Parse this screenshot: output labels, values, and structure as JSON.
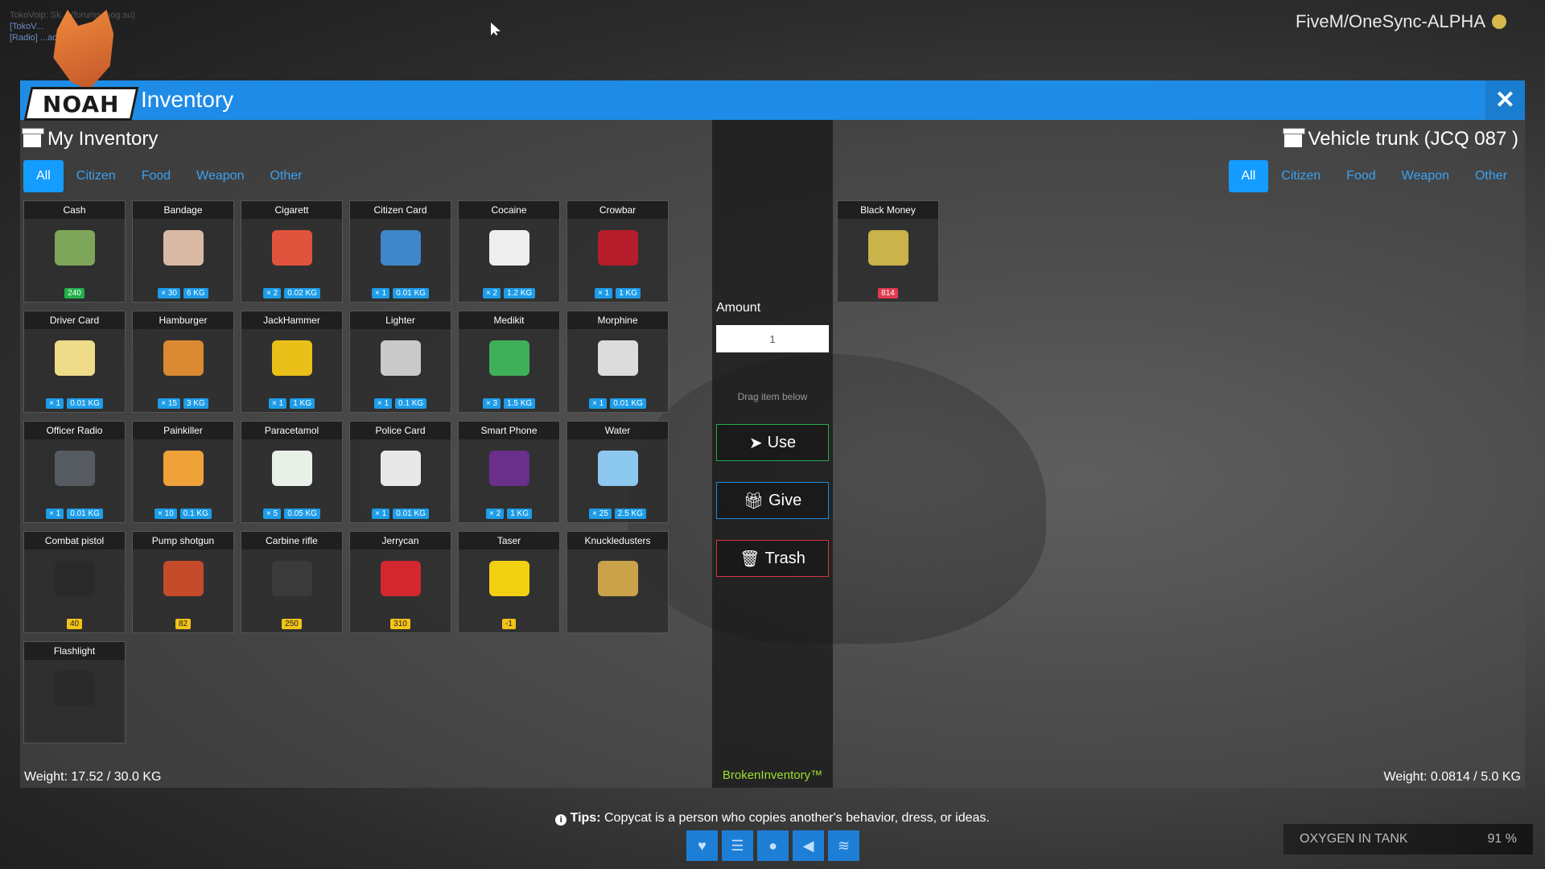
{
  "server_tag": "FiveM/OneSync-ALPHA",
  "chat": [
    "TokoVoip: Sk... (forums.mog.su)",
    "[TokoV...",
    "[Radio] ...adio"
  ],
  "header": {
    "title": "Inventory",
    "brand": "NOAH"
  },
  "left": {
    "title": "My Inventory",
    "filters": [
      "All",
      "Citizen",
      "Food",
      "Weapon",
      "Other"
    ],
    "weight": "Weight: 17.52 / 30.0 KG",
    "items": [
      {
        "name": "Cash",
        "tags": [
          {
            "text": "240",
            "kind": "green"
          }
        ],
        "color": "#7ea65a"
      },
      {
        "name": "Bandage",
        "tags": [
          {
            "text": "× 30",
            "kind": "blue"
          },
          {
            "text": "6 KG",
            "kind": "blue"
          }
        ],
        "color": "#d9b9a3"
      },
      {
        "name": "Cigarett",
        "tags": [
          {
            "text": "× 2",
            "kind": "blue"
          },
          {
            "text": "0.02 KG",
            "kind": "blue"
          }
        ],
        "color": "#e0533d"
      },
      {
        "name": "Citizen Card",
        "tags": [
          {
            "text": "× 1",
            "kind": "blue"
          },
          {
            "text": "0.01 KG",
            "kind": "blue"
          }
        ],
        "color": "#3f86c9"
      },
      {
        "name": "Cocaine",
        "tags": [
          {
            "text": "× 2",
            "kind": "blue"
          },
          {
            "text": "1.2 KG",
            "kind": "blue"
          }
        ],
        "color": "#eeeeee"
      },
      {
        "name": "Crowbar",
        "tags": [
          {
            "text": "× 1",
            "kind": "blue"
          },
          {
            "text": "1 KG",
            "kind": "blue"
          }
        ],
        "color": "#b51d2a"
      },
      {
        "name": "Driver Card",
        "tags": [
          {
            "text": "× 1",
            "kind": "blue"
          },
          {
            "text": "0.01 KG",
            "kind": "blue"
          }
        ],
        "color": "#efdc8a"
      },
      {
        "name": "Hamburger",
        "tags": [
          {
            "text": "× 15",
            "kind": "blue"
          },
          {
            "text": "3 KG",
            "kind": "blue"
          }
        ],
        "color": "#d98a32"
      },
      {
        "name": "JackHammer",
        "tags": [
          {
            "text": "× 1",
            "kind": "blue"
          },
          {
            "text": "1 KG",
            "kind": "blue"
          }
        ],
        "color": "#e8c018"
      },
      {
        "name": "Lighter",
        "tags": [
          {
            "text": "× 1",
            "kind": "blue"
          },
          {
            "text": "0.1 KG",
            "kind": "blue"
          }
        ],
        "color": "#c9c9c9"
      },
      {
        "name": "Medikit",
        "tags": [
          {
            "text": "× 3",
            "kind": "blue"
          },
          {
            "text": "1.5 KG",
            "kind": "blue"
          }
        ],
        "color": "#3fb05a"
      },
      {
        "name": "Morphine",
        "tags": [
          {
            "text": "× 1",
            "kind": "blue"
          },
          {
            "text": "0.01 KG",
            "kind": "blue"
          }
        ],
        "color": "#dcdcdc"
      },
      {
        "name": "Officer Radio",
        "tags": [
          {
            "text": "× 1",
            "kind": "blue"
          },
          {
            "text": "0.01 KG",
            "kind": "blue"
          }
        ],
        "color": "#555b60"
      },
      {
        "name": "Painkiller",
        "tags": [
          {
            "text": "× 10",
            "kind": "blue"
          },
          {
            "text": "0.1 KG",
            "kind": "blue"
          }
        ],
        "color": "#f0a23a"
      },
      {
        "name": "Paracetamol",
        "tags": [
          {
            "text": "× 5",
            "kind": "blue"
          },
          {
            "text": "0.05 KG",
            "kind": "blue"
          }
        ],
        "color": "#e8f0e8"
      },
      {
        "name": "Police Card",
        "tags": [
          {
            "text": "× 1",
            "kind": "blue"
          },
          {
            "text": "0.01 KG",
            "kind": "blue"
          }
        ],
        "color": "#e8e8e8"
      },
      {
        "name": "Smart Phone",
        "tags": [
          {
            "text": "× 2",
            "kind": "blue"
          },
          {
            "text": "1 KG",
            "kind": "blue"
          }
        ],
        "color": "#6a2f8a"
      },
      {
        "name": "Water",
        "tags": [
          {
            "text": "× 25",
            "kind": "blue"
          },
          {
            "text": "2.5 KG",
            "kind": "blue"
          }
        ],
        "color": "#8cc8ef"
      },
      {
        "name": "Combat pistol",
        "tags": [
          {
            "text": "40",
            "kind": "yellow"
          }
        ],
        "color": "#2a2a2a"
      },
      {
        "name": "Pump shotgun",
        "tags": [
          {
            "text": "82",
            "kind": "yellow"
          }
        ],
        "color": "#c64b2a"
      },
      {
        "name": "Carbine rifle",
        "tags": [
          {
            "text": "250",
            "kind": "yellow"
          }
        ],
        "color": "#3a3a3a"
      },
      {
        "name": "Jerrycan",
        "tags": [
          {
            "text": "310",
            "kind": "yellow"
          }
        ],
        "color": "#d3282f"
      },
      {
        "name": "Taser",
        "tags": [
          {
            "text": "-1",
            "kind": "yellow"
          }
        ],
        "color": "#f2d012"
      },
      {
        "name": "Knuckledusters",
        "tags": [],
        "color": "#c9a24a"
      },
      {
        "name": "Flashlight",
        "tags": [],
        "color": "#2a2a2a"
      }
    ]
  },
  "middle": {
    "amount_label": "Amount",
    "amount_value": "1",
    "drag_hint": "Drag item below",
    "use_label": "Use",
    "give_label": "Give",
    "trash_label": "Trash",
    "brand": "BrokenInventory™"
  },
  "right": {
    "title": "Vehicle trunk (JCQ 087 )",
    "filters": [
      "All",
      "Citizen",
      "Food",
      "Weapon",
      "Other"
    ],
    "weight": "Weight: 0.0814 / 5.0 KG",
    "items": [
      {
        "name": "Black Money",
        "tags": [
          {
            "text": "814",
            "kind": "red"
          }
        ],
        "color": "#c9b34a"
      }
    ]
  },
  "tips": {
    "prefix": "Tips:",
    "text": "Copycat is a person who copies another's behavior, dress, or ideas."
  },
  "status_icons": [
    "heart-icon",
    "burger-icon",
    "water-drop-icon",
    "speaker-icon",
    "waves-icon"
  ],
  "oxygen": {
    "label": "OXYGEN IN TANK",
    "value": "91 %"
  }
}
